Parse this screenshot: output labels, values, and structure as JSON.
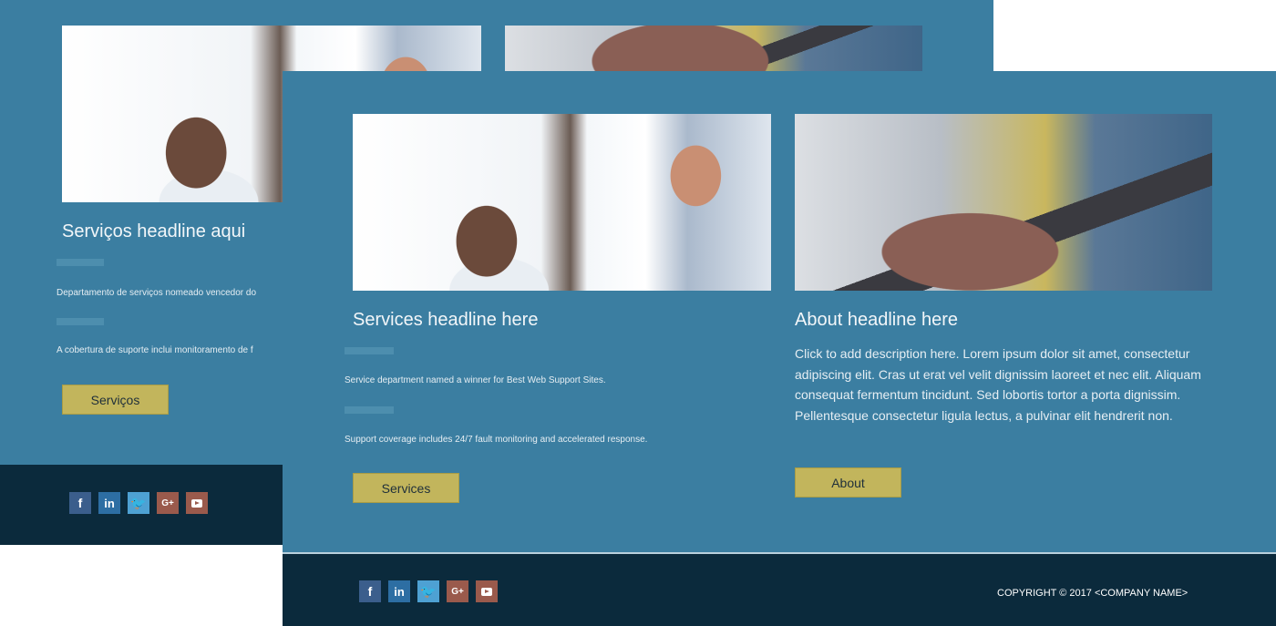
{
  "back_page": {
    "services": {
      "headline": "Serviços headline aqui",
      "item1": "Departamento de serviços nomeado vencedor do",
      "item2": "A cobertura de suporte inclui monitoramento de f",
      "button_label": "Serviços"
    }
  },
  "front_page": {
    "services": {
      "headline": "Services headline here",
      "item1": "Service department named a winner for Best Web Support Sites.",
      "item2": "Support coverage includes 24/7 fault monitoring and accelerated response.",
      "button_label": "Services"
    },
    "about": {
      "headline": "About headline here",
      "description": "Click to add description here. Lorem ipsum dolor sit amet, consectetur adipiscing elit. Cras ut erat vel velit dignissim laoreet et nec elit. Aliquam consequat fermentum tincidunt. Sed lobortis tortor a porta dignissim. Pellentesque consectetur ligula lectus, a pulvinar elit hendrerit non.",
      "button_label": "About"
    },
    "footer": {
      "copyright": "COPYRIGHT © 2017 <COMPANY NAME>"
    }
  },
  "social_icons": [
    {
      "name": "facebook-icon",
      "glyph": "f"
    },
    {
      "name": "linkedin-icon",
      "glyph": "in"
    },
    {
      "name": "twitter-icon",
      "glyph": "🐦"
    },
    {
      "name": "google-plus-icon",
      "glyph": "G+"
    },
    {
      "name": "youtube-icon",
      "glyph": ""
    }
  ],
  "colors": {
    "page_bg": "#3b7ea1",
    "footer_bg": "#0b2a3c",
    "button_bg": "#c2b55c"
  }
}
